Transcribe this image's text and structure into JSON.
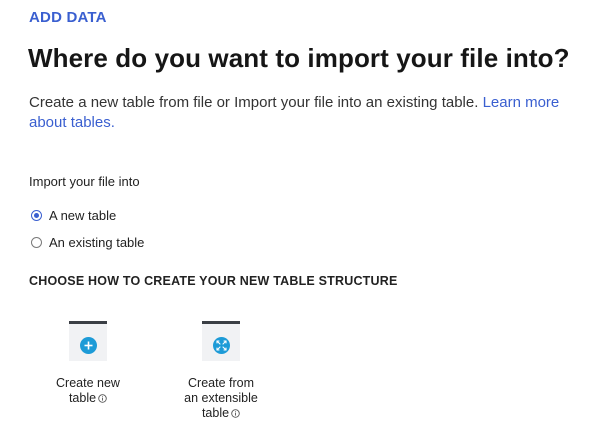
{
  "header": {
    "eyebrow": "ADD DATA",
    "title": "Where do you want to import your file into?"
  },
  "intro": {
    "text": "Create a new table from file or Import your file into an existing table. ",
    "link_text": "Learn more about tables."
  },
  "import": {
    "label": "Import your file into",
    "options": [
      {
        "label": "A new table",
        "selected": true
      },
      {
        "label": "An existing table",
        "selected": false
      }
    ]
  },
  "structure": {
    "heading": "CHOOSE HOW TO CREATE YOUR NEW TABLE STRUCTURE",
    "cards": [
      {
        "line1": "Create new",
        "line2": "table",
        "icon": "plus-icon"
      },
      {
        "line1": "Create from",
        "line2": "an extensible",
        "line3": "table",
        "icon": "expand-arrows-icon"
      }
    ]
  },
  "colors": {
    "accent": "#3a5fd0",
    "icon_badge": "#1d9bd7",
    "thumb_bar": "#3b3f45",
    "thumb_bg": "#f1f2f4"
  }
}
